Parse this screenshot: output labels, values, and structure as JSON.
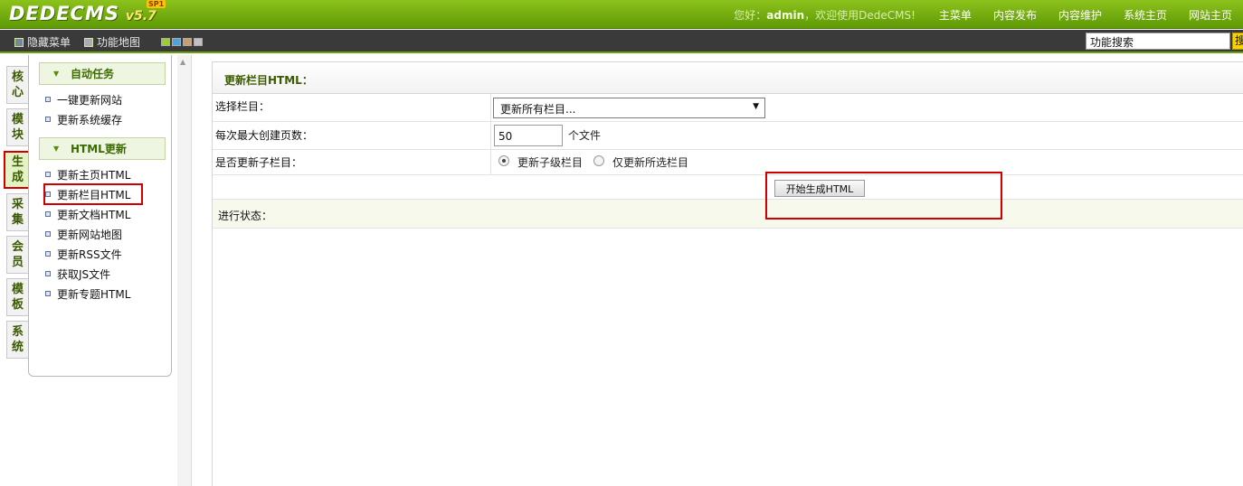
{
  "header": {
    "logo_text": "DEDECMS",
    "logo_version": "v5.7",
    "logo_badge": "SP1",
    "welcome_prefix": "您好：",
    "welcome_user": "admin",
    "welcome_suffix": "，欢迎使用DedeCMS!",
    "nav": [
      "主菜单",
      "内容发布",
      "内容维护",
      "系统主页",
      "网站主页"
    ]
  },
  "toolbar": {
    "hide_menu": "隐藏菜单",
    "site_map": "功能地图",
    "search_placeholder": "功能搜索",
    "search_button": "搜",
    "swatch_colors": [
      "#9acd32",
      "#4fa3d8",
      "#c8a070",
      "#c0c0c0"
    ]
  },
  "vtabs": [
    {
      "c1": "核",
      "c2": "心"
    },
    {
      "c1": "模",
      "c2": "块"
    },
    {
      "c1": "生",
      "c2": "成"
    },
    {
      "c1": "采",
      "c2": "集"
    },
    {
      "c1": "会",
      "c2": "员"
    },
    {
      "c1": "模",
      "c2": "板"
    },
    {
      "c1": "系",
      "c2": "统"
    }
  ],
  "menu": {
    "group1_title": "自动任务",
    "group1_items": [
      "一键更新网站",
      "更新系统缓存"
    ],
    "group2_title": "HTML更新",
    "group2_items": [
      "更新主页HTML",
      "更新栏目HTML",
      "更新文档HTML",
      "更新网站地图",
      "更新RSS文件",
      "获取JS文件",
      "更新专题HTML"
    ]
  },
  "main": {
    "title": "更新栏目HTML：",
    "select_label": "选择栏目：",
    "select_value": "更新所有栏目...",
    "max_pages_label": "每次最大创建页数：",
    "max_pages_value": "50",
    "max_pages_unit": "个文件",
    "update_children_label": "是否更新子栏目：",
    "radio_children": "更新子级栏目",
    "radio_selected_only": "仅更新所选栏目",
    "generate_button": "开始生成HTML",
    "status_label": "进行状态："
  }
}
